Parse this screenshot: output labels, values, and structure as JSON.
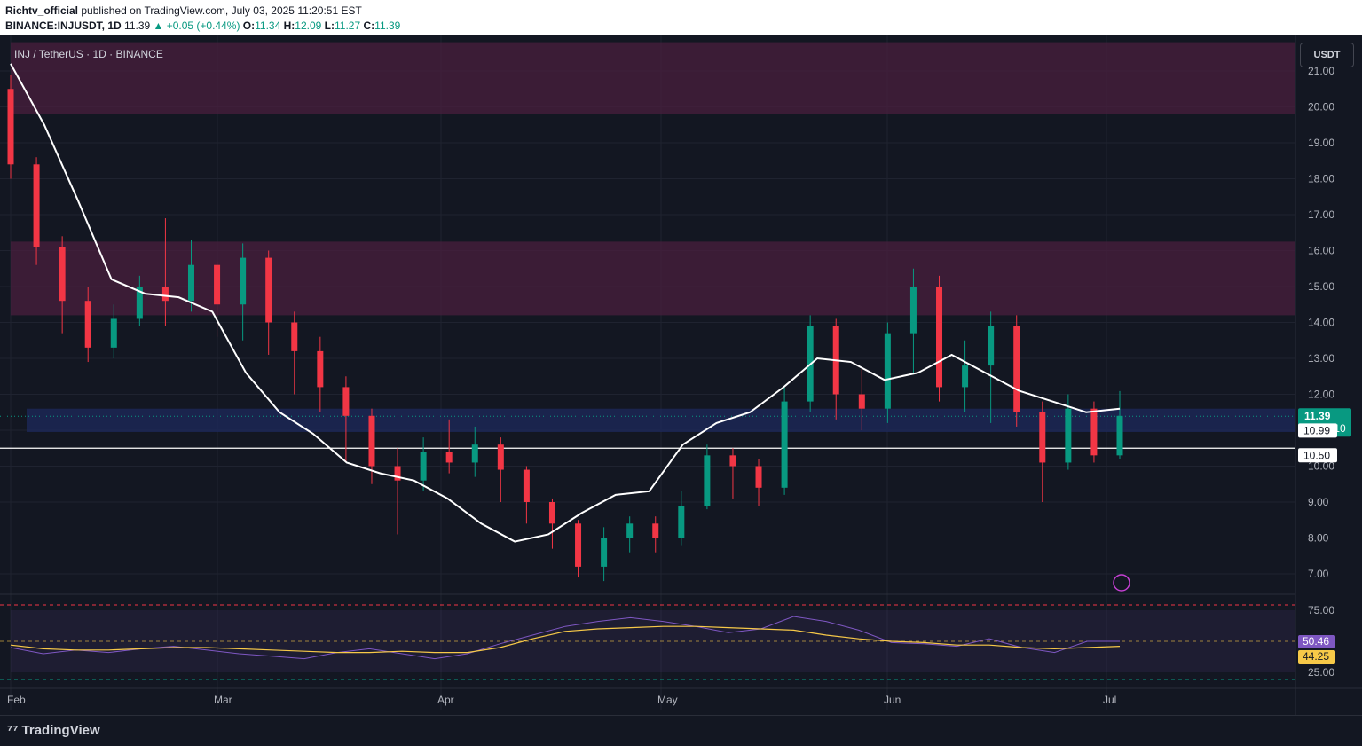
{
  "header": {
    "author": "Richtv_official",
    "published": "published on TradingView.com, July 03, 2025 11:20:51 EST",
    "symbol": "BINANCE:INJUSDT, 1D",
    "last": "11.39",
    "change": "▲ +0.05 (+0.44%)",
    "o_label": "O:",
    "o": "11.34",
    "h_label": "H:",
    "h": "12.09",
    "l_label": "L:",
    "l": "11.27",
    "c_label": "C:",
    "c": "11.39"
  },
  "pane": {
    "symbol_label": "INJ / TetherUS · 1D · BINANCE",
    "currency_button": "USDT"
  },
  "footer": {
    "logo_text": "TradingView"
  },
  "colors": {
    "background": "#131722",
    "up": "#089981",
    "down": "#f23645",
    "ma": "#ffffff",
    "rsi": "#7e57c2",
    "rsi_ma": "#f7c948",
    "supply_zone": "#4a1f3d",
    "demand_zone": "#1e2a5c"
  },
  "chart_data": {
    "type": "candlestick",
    "title": "INJ / TetherUS · 1D · BINANCE",
    "price_axis_ticks": [
      "21.00",
      "20.00",
      "19.00",
      "18.00",
      "17.00",
      "16.00",
      "15.00",
      "14.00",
      "13.00",
      "12.00",
      "11.00",
      "10.00",
      "9.00",
      "8.00",
      "7.00"
    ],
    "y_range": [
      6.5,
      21.8
    ],
    "x_ticks": [
      "Feb",
      "Mar",
      "Apr",
      "May",
      "Jun",
      "Jul"
    ],
    "price_labels": {
      "last": "11.39",
      "countdown": "07:39:10",
      "line_a": "10.99",
      "line_b": "10.50"
    },
    "zones": [
      {
        "kind": "supply",
        "from": 19.8,
        "to": 22.0
      },
      {
        "kind": "supply",
        "from": 14.2,
        "to": 16.25
      },
      {
        "kind": "demand",
        "from": 10.95,
        "to": 11.6
      }
    ],
    "horizontal_line": 10.5,
    "ma_path": [
      21.2,
      19.5,
      17.4,
      15.2,
      14.8,
      14.7,
      14.3,
      12.6,
      11.5,
      10.9,
      10.1,
      9.8,
      9.6,
      9.1,
      8.4,
      7.9,
      8.1,
      8.7,
      9.2,
      9.3,
      10.6,
      11.2,
      11.5,
      12.2,
      13.0,
      12.9,
      12.4,
      12.6,
      13.1,
      12.6,
      12.1,
      11.8,
      11.5,
      11.6
    ],
    "candles_open_close": [
      [
        20.5,
        18.4
      ],
      [
        18.4,
        16.1
      ],
      [
        16.1,
        14.6
      ],
      [
        14.6,
        13.3
      ],
      [
        13.3,
        14.1
      ],
      [
        14.1,
        15.0
      ],
      [
        15.0,
        14.6
      ],
      [
        14.6,
        15.6
      ],
      [
        15.6,
        14.5
      ],
      [
        14.5,
        15.8
      ],
      [
        15.8,
        14.0
      ],
      [
        14.0,
        13.2
      ],
      [
        13.2,
        12.2
      ],
      [
        12.2,
        11.4
      ],
      [
        11.4,
        10.0
      ],
      [
        10.0,
        9.6
      ],
      [
        9.6,
        10.4
      ],
      [
        10.4,
        10.1
      ],
      [
        10.1,
        10.6
      ],
      [
        10.6,
        9.9
      ],
      [
        9.9,
        9.0
      ],
      [
        9.0,
        8.4
      ],
      [
        8.4,
        7.2
      ],
      [
        7.2,
        8.0
      ],
      [
        8.0,
        8.4
      ],
      [
        8.4,
        8.0
      ],
      [
        8.0,
        8.9
      ],
      [
        8.9,
        10.3
      ],
      [
        10.3,
        10.0
      ],
      [
        10.0,
        9.4
      ],
      [
        9.4,
        11.8
      ],
      [
        11.8,
        13.9
      ],
      [
        13.9,
        12.0
      ],
      [
        12.0,
        11.6
      ],
      [
        11.6,
        13.7
      ],
      [
        13.7,
        15.0
      ],
      [
        15.0,
        12.2
      ],
      [
        12.2,
        12.8
      ],
      [
        12.8,
        13.9
      ],
      [
        13.9,
        11.5
      ],
      [
        11.5,
        10.1
      ],
      [
        10.1,
        11.6
      ],
      [
        11.6,
        10.3
      ],
      [
        10.3,
        11.4
      ]
    ],
    "candles_high_low": [
      [
        20.9,
        18.0
      ],
      [
        18.6,
        15.6
      ],
      [
        16.4,
        13.7
      ],
      [
        15.0,
        12.9
      ],
      [
        14.5,
        13.0
      ],
      [
        15.3,
        13.9
      ],
      [
        16.9,
        13.9
      ],
      [
        16.3,
        14.3
      ],
      [
        15.7,
        13.6
      ],
      [
        16.2,
        13.5
      ],
      [
        16.0,
        13.1
      ],
      [
        14.3,
        12.0
      ],
      [
        13.6,
        11.5
      ],
      [
        12.5,
        10.1
      ],
      [
        11.6,
        9.5
      ],
      [
        10.5,
        8.1
      ],
      [
        10.8,
        9.3
      ],
      [
        11.3,
        9.8
      ],
      [
        11.1,
        9.7
      ],
      [
        10.8,
        9.0
      ],
      [
        10.0,
        8.4
      ],
      [
        9.1,
        7.7
      ],
      [
        8.5,
        6.9
      ],
      [
        8.3,
        6.8
      ],
      [
        8.6,
        7.6
      ],
      [
        8.6,
        7.6
      ],
      [
        9.3,
        7.8
      ],
      [
        10.6,
        8.8
      ],
      [
        10.5,
        9.1
      ],
      [
        10.2,
        8.9
      ],
      [
        12.2,
        9.2
      ],
      [
        14.2,
        11.5
      ],
      [
        14.1,
        11.3
      ],
      [
        12.7,
        11.0
      ],
      [
        14.0,
        11.2
      ],
      [
        15.5,
        12.6
      ],
      [
        15.3,
        11.8
      ],
      [
        13.5,
        11.5
      ],
      [
        14.3,
        11.2
      ],
      [
        14.2,
        11.1
      ],
      [
        11.8,
        9.0
      ],
      [
        12.0,
        9.9
      ],
      [
        11.8,
        10.1
      ],
      [
        12.09,
        10.2
      ]
    ],
    "rsi_pane": {
      "ticks": [
        "75.00",
        "25.00"
      ],
      "rsi_value": "50.46",
      "rsi_ma_value": "44.25",
      "upper_band": 75,
      "mid": 50,
      "lower_band": 25
    }
  }
}
